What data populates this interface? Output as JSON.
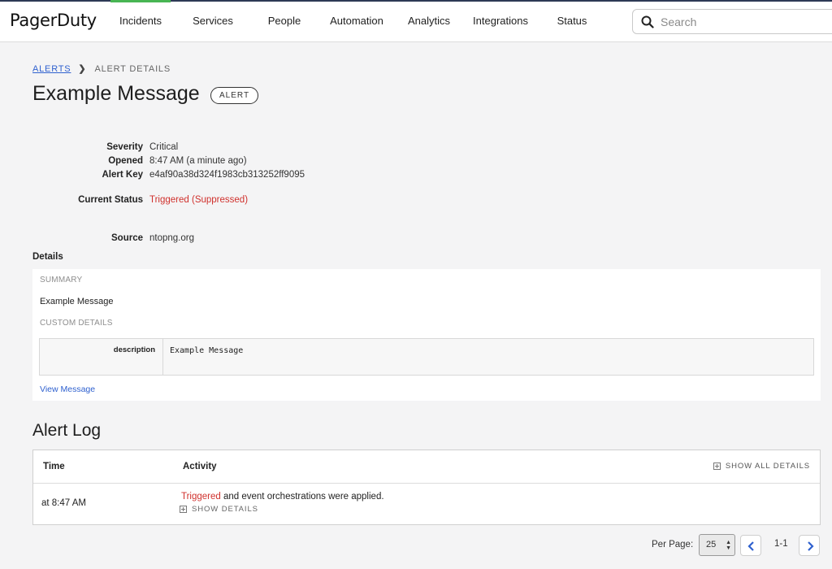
{
  "nav": {
    "logo": "PagerDuty",
    "items": [
      {
        "label": "Incidents"
      },
      {
        "label": "Services"
      },
      {
        "label": "People"
      },
      {
        "label": "Automation"
      },
      {
        "label": "Analytics"
      },
      {
        "label": "Integrations"
      },
      {
        "label": "Status"
      }
    ],
    "active_item": "Incidents",
    "accent_color": "#48b553",
    "search_placeholder": "Search"
  },
  "breadcrumb": {
    "parent": "ALERTS",
    "current": "ALERT DETAILS"
  },
  "header": {
    "title": "Example Message",
    "badge": "ALERT"
  },
  "meta": {
    "severity_label": "Severity",
    "severity": "Critical",
    "opened_label": "Opened",
    "opened": "8:47 AM (a minute ago)",
    "alert_key_label": "Alert Key",
    "alert_key": "e4af90a38d324f1983cb313252ff9095",
    "status_label": "Current Status",
    "status": "Triggered (Suppressed)",
    "status_color": "#d0312d",
    "source_label": "Source",
    "source": "ntopng.org"
  },
  "details": {
    "label": "Details",
    "summary_heading": "SUMMARY",
    "summary": "Example Message",
    "custom_heading": "CUSTOM DETAILS",
    "custom_details": [
      {
        "key": "description",
        "value": "Example Message"
      }
    ],
    "view_message": "View Message"
  },
  "log": {
    "title": "Alert Log",
    "col_time": "Time",
    "col_activity": "Activity",
    "show_all": "SHOW ALL DETAILS",
    "entries": [
      {
        "time": "at 8:47 AM",
        "event": "Triggered",
        "text": " and event orchestrations were applied.",
        "show_details": "SHOW DETAILS"
      }
    ]
  },
  "pagination": {
    "per_page_label": "Per Page:",
    "per_page": "25",
    "range": "1-1"
  }
}
